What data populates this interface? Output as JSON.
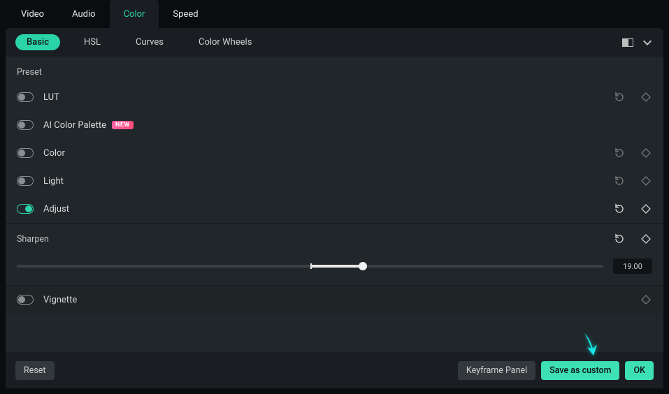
{
  "top_tabs": {
    "video": "Video",
    "audio": "Audio",
    "color": "Color",
    "speed": "Speed",
    "active": "color"
  },
  "sub_tabs": {
    "basic": "Basic",
    "hsl": "HSL",
    "curves": "Curves",
    "color_wheels": "Color Wheels",
    "active": "basic"
  },
  "preset": {
    "label": "Preset"
  },
  "rows": {
    "lut": {
      "label": "LUT",
      "on": false,
      "reset": true,
      "keyframe": true
    },
    "ai": {
      "label": "AI Color Palette",
      "on": false,
      "badge": "NEW"
    },
    "color": {
      "label": "Color",
      "on": false,
      "reset": true,
      "keyframe": true
    },
    "light": {
      "label": "Light",
      "on": false,
      "reset": true,
      "keyframe": true
    },
    "adjust": {
      "label": "Adjust",
      "on": true,
      "reset": true,
      "keyframe": true,
      "bright": true
    }
  },
  "sharpen": {
    "label": "Sharpen",
    "value": "19.00",
    "percent": 59
  },
  "vignette": {
    "label": "Vignette",
    "on": false,
    "keyframe": true
  },
  "footer": {
    "reset": "Reset",
    "keyframe_panel": "Keyframe Panel",
    "save_custom": "Save as custom",
    "ok": "OK"
  },
  "colors": {
    "accent": "#2bd4a8",
    "arrow": "#17e6e6"
  }
}
